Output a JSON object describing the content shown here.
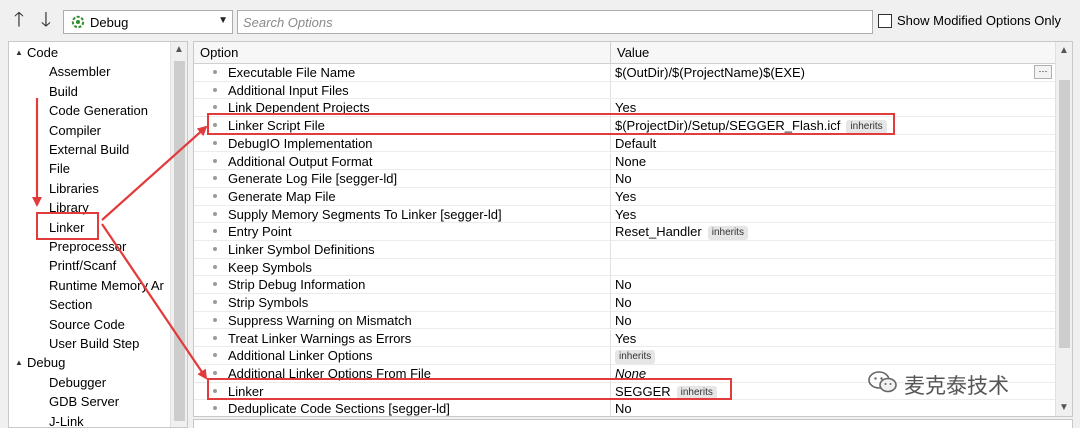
{
  "toolbar": {
    "config": "Debug",
    "search_placeholder": "Search Options",
    "show_modified_label": "Show Modified Options Only",
    "show_modified_checked": false
  },
  "tree": {
    "items": [
      {
        "label": "Code",
        "caret": "▲",
        "level": 0
      },
      {
        "label": "Assembler",
        "level": 1
      },
      {
        "label": "Build",
        "level": 1
      },
      {
        "label": "Code Generation",
        "level": 1
      },
      {
        "label": "Compiler",
        "level": 1
      },
      {
        "label": "External Build",
        "level": 1
      },
      {
        "label": "File",
        "level": 1
      },
      {
        "label": "Libraries",
        "level": 1
      },
      {
        "label": "Library",
        "level": 1
      },
      {
        "label": "Linker",
        "level": 1,
        "selected": true
      },
      {
        "label": "Preprocessor",
        "level": 1
      },
      {
        "label": "Printf/Scanf",
        "level": 1
      },
      {
        "label": "Runtime Memory Ar",
        "level": 1
      },
      {
        "label": "Section",
        "level": 1
      },
      {
        "label": "Source Code",
        "level": 1
      },
      {
        "label": "User Build Step",
        "level": 1
      },
      {
        "label": "Debug",
        "caret": "▲",
        "level": 0
      },
      {
        "label": "Debugger",
        "level": 1
      },
      {
        "label": "GDB Server",
        "level": 1
      },
      {
        "label": "J-Link",
        "level": 1
      }
    ]
  },
  "grid": {
    "headers": {
      "option": "Option",
      "value": "Value"
    },
    "rows": [
      {
        "option": "Executable File Name",
        "value": "$(OutDir)/$(ProjectName)$(EXE)",
        "ellipsis": "···"
      },
      {
        "option": "Additional Input Files",
        "value": ""
      },
      {
        "option": "Link Dependent Projects",
        "value": "Yes"
      },
      {
        "option": "Linker Script File",
        "value": "$(ProjectDir)/Setup/SEGGER_Flash.icf",
        "badge": "inherits",
        "highlight": true
      },
      {
        "option": "DebugIO Implementation",
        "value": "Default"
      },
      {
        "option": "Additional Output Format",
        "value": "None"
      },
      {
        "option": "Generate Log File [segger-ld]",
        "value": "No"
      },
      {
        "option": "Generate Map File",
        "value": "Yes"
      },
      {
        "option": "Supply Memory Segments To Linker [segger-ld]",
        "value": "Yes"
      },
      {
        "option": "Entry Point",
        "value": "Reset_Handler",
        "badge": "inherits"
      },
      {
        "option": "Linker Symbol Definitions",
        "value": ""
      },
      {
        "option": "Keep Symbols",
        "value": ""
      },
      {
        "option": "Strip Debug Information",
        "value": "No"
      },
      {
        "option": "Strip Symbols",
        "value": "No"
      },
      {
        "option": "Suppress Warning on Mismatch",
        "value": "No"
      },
      {
        "option": "Treat Linker Warnings as Errors",
        "value": "Yes"
      },
      {
        "option": "Additional Linker Options",
        "value": "",
        "badge": "inherits"
      },
      {
        "option": "Additional Linker Options From File",
        "value": "None",
        "italic": true
      },
      {
        "option": "Linker",
        "value": "SEGGER",
        "badge": "inherits",
        "highlight": true
      },
      {
        "option": "Deduplicate Code Sections [segger-ld]",
        "value": "No"
      }
    ]
  },
  "watermark": {
    "text": "麦克泰技术"
  },
  "colors": {
    "annotation": "#e23b3b"
  }
}
